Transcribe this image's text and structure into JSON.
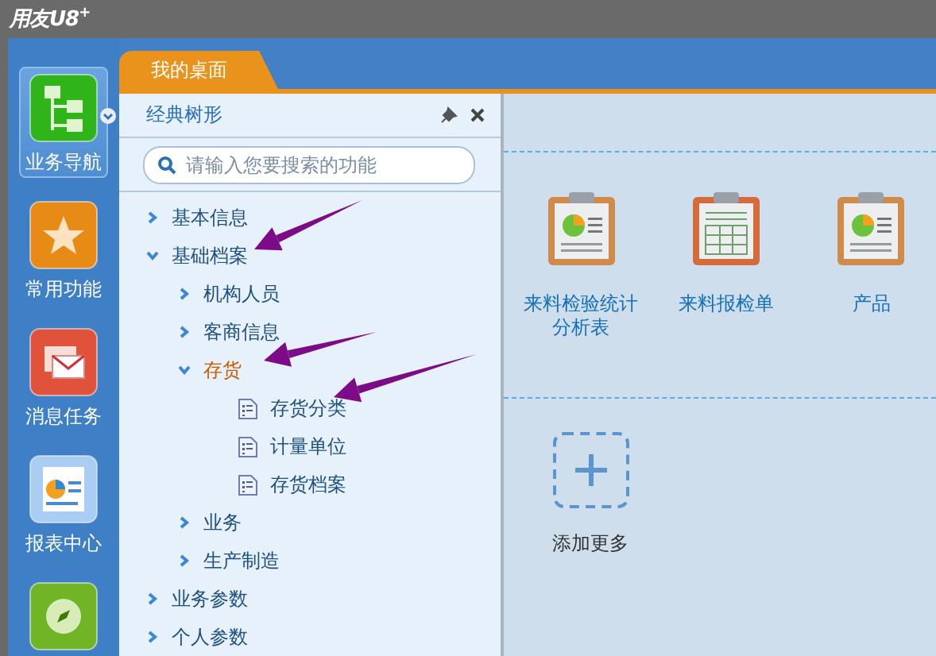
{
  "window": {
    "title": "用友U8",
    "title_sup": "+"
  },
  "nav": [
    {
      "kind": "tree",
      "label": "业务导航",
      "selected": true
    },
    {
      "kind": "star",
      "label": "常用功能",
      "selected": false
    },
    {
      "kind": "mail",
      "label": "消息任务",
      "selected": false
    },
    {
      "kind": "report",
      "label": "报表中心",
      "selected": false
    },
    {
      "kind": "compass",
      "selected": false
    }
  ],
  "tabs": [
    {
      "label": "我的桌面",
      "selected": true
    }
  ],
  "tree_panel": {
    "title": "经典树形",
    "search": {
      "placeholder": "请输入您要搜索的功能"
    },
    "items": [
      {
        "kind": "folder",
        "label": "基本信息",
        "expanded": false,
        "selected": false
      },
      {
        "kind": "folder",
        "label": "基础档案",
        "expanded": true,
        "selected": false,
        "children": [
          {
            "kind": "folder",
            "label": "机构人员",
            "expanded": false,
            "selected": false
          },
          {
            "kind": "folder",
            "label": "客商信息",
            "expanded": false,
            "selected": false
          },
          {
            "kind": "folder",
            "label": "存货",
            "expanded": true,
            "selected": true,
            "children": [
              {
                "kind": "doc",
                "label": "存货分类",
                "selected": false
              },
              {
                "kind": "doc",
                "label": "计量单位",
                "selected": false
              },
              {
                "kind": "doc",
                "label": "存货档案",
                "selected": false
              }
            ]
          },
          {
            "kind": "folder",
            "label": "业务",
            "expanded": false,
            "selected": false
          },
          {
            "kind": "folder",
            "label": "生产制造",
            "expanded": false,
            "selected": false
          }
        ]
      },
      {
        "kind": "folder",
        "label": "业务参数",
        "expanded": false,
        "selected": false
      },
      {
        "kind": "folder",
        "label": "个人参数",
        "expanded": false,
        "selected": false
      }
    ]
  },
  "shortcuts": [
    {
      "kind": "chart",
      "label": "来料检验统计分析表"
    },
    {
      "kind": "table",
      "label": "来料报检单"
    },
    {
      "kind": "chart",
      "label": "产品"
    }
  ],
  "add_more": {
    "label": "添加更多"
  }
}
